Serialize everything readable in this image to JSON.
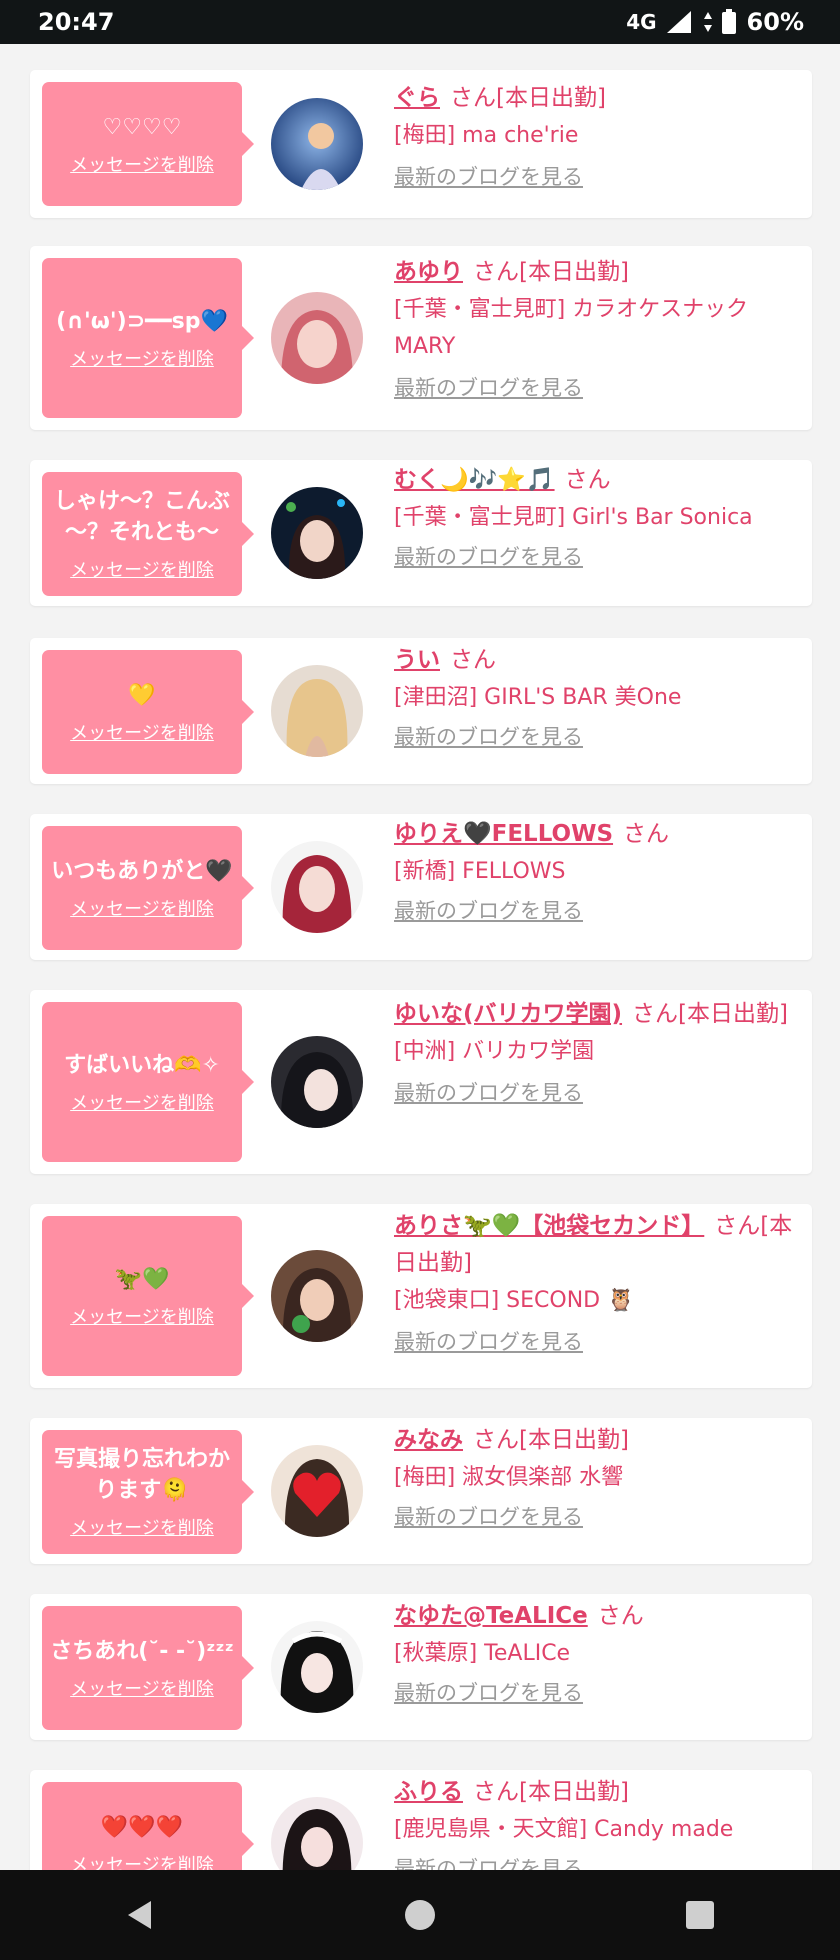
{
  "status_bar": {
    "time": "20:47",
    "network": "4G",
    "battery": "60%"
  },
  "delete_label": "メッセージを削除",
  "blog_label": "最新のブログを見る",
  "colors": {
    "accent": "#e0426a",
    "bubble": "#ff8fa3",
    "status_bar": "#111516"
  },
  "cards": [
    {
      "message": "♡♡♡♡",
      "name": "ぐら",
      "suffix": "さん[本日出勤]",
      "shop": "[梅田] ma che'rie"
    },
    {
      "message": "(∩'ω')⊃━━sp💙",
      "name": "あゆり",
      "suffix": "さん[本日出勤]",
      "shop": "[千葉・富士見町] カラオケスナックMARY"
    },
    {
      "message": "しゃけ～？こんぶ～？それとも～",
      "name": "むく🌙🎶⭐🎵",
      "suffix": "さん",
      "shop": "[千葉・富士見町] Girl's Bar Sonica"
    },
    {
      "message": "💛",
      "name": "うい",
      "suffix": "さん",
      "shop": "[津田沼] GIRL'S BAR 美One"
    },
    {
      "message": "いつもありがと🖤",
      "name": "ゆりえ🖤FELLOWS",
      "suffix": "さん",
      "shop": "[新橋] FELLOWS"
    },
    {
      "message": "すばいいね🫶✧",
      "name": "ゆいな(バリカワ学園)",
      "suffix": "さん[本日出勤]",
      "shop": "[中洲] バリカワ学園"
    },
    {
      "message": "🦖💚",
      "name": "ありさ🦖💚【池袋セカンド】",
      "suffix": "さん[本日出勤]",
      "shop": "[池袋東口] SECOND 🦉"
    },
    {
      "message": "写真撮り忘れわかります🫠",
      "name": "みなみ",
      "suffix": "さん[本日出勤]",
      "shop": "[梅田] 淑女倶楽部 水響"
    },
    {
      "message": "さちあれ(˘- -˘)ᶻᶻᶻ",
      "name": "なゆた@TeALICe",
      "suffix": "さん",
      "shop": "[秋葉原] TeALICe"
    },
    {
      "message": "❤️❤️❤️",
      "name": "ふりる",
      "suffix": "さん[本日出勤]",
      "shop": "[鹿児島県・天文館] Candy made"
    }
  ]
}
